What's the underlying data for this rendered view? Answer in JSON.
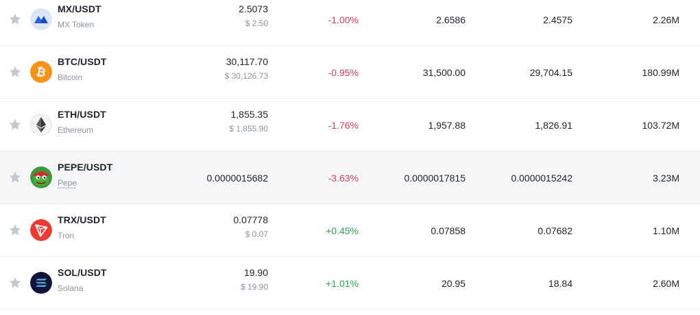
{
  "colors": {
    "negative": "#e03c5a",
    "positive": "#2aa655",
    "star": "#c4c8cf",
    "muted_text": "#8d939e",
    "highlight_row": "#f5f6f8"
  },
  "rows": [
    {
      "pair": "MX/USDT",
      "name": "MX Token",
      "icon": "mx-token-icon",
      "price": "2.5073",
      "usd_price": "$ 2.50",
      "change": "-1.00%",
      "high": "2.6586",
      "low": "2.4575",
      "volume": "2.26M"
    },
    {
      "pair": "BTC/USDT",
      "name": "Bitcoin",
      "icon": "bitcoin-icon",
      "price": "30,117.70",
      "usd_price": "$ 30,126.73",
      "change": "-0.95%",
      "high": "31,500.00",
      "low": "29,704.15",
      "volume": "180.99M"
    },
    {
      "pair": "ETH/USDT",
      "name": "Ethereum",
      "icon": "ethereum-icon",
      "price": "1,855.35",
      "usd_price": "$ 1,855.90",
      "change": "-1.76%",
      "high": "1,957.88",
      "low": "1,826.91",
      "volume": "103.72M"
    },
    {
      "pair": "PEPE/USDT",
      "name": "Pepe",
      "icon": "pepe-icon",
      "price": "0.0000015682",
      "usd_price": "",
      "change": "-3.63%",
      "high": "0.0000017815",
      "low": "0.0000015242",
      "volume": "3.23M"
    },
    {
      "pair": "TRX/USDT",
      "name": "Tron",
      "icon": "tron-icon",
      "price": "0.07778",
      "usd_price": "$ 0.07",
      "change": "+0.45%",
      "high": "0.07858",
      "low": "0.07682",
      "volume": "1.10M"
    },
    {
      "pair": "SOL/USDT",
      "name": "Solana",
      "icon": "solana-icon",
      "price": "19.90",
      "usd_price": "$ 19.90",
      "change": "+1.01%",
      "high": "20.95",
      "low": "18.84",
      "volume": "2.60M"
    }
  ]
}
